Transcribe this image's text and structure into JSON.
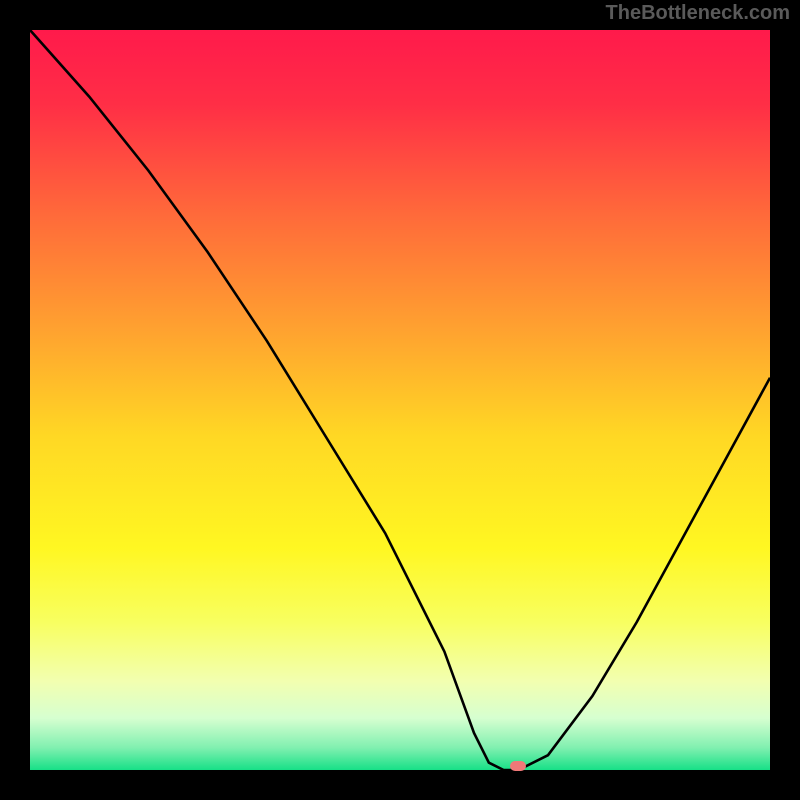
{
  "watermark": "TheBottleneck.com",
  "chart_data": {
    "type": "line",
    "title": "",
    "xlabel": "",
    "ylabel": "",
    "x_range": [
      0,
      100
    ],
    "y_range": [
      0,
      100
    ],
    "series": [
      {
        "name": "bottleneck-curve",
        "x": [
          0,
          8,
          16,
          24,
          32,
          40,
          48,
          56,
          60,
          62,
          64,
          66,
          70,
          76,
          82,
          88,
          94,
          100
        ],
        "y": [
          100,
          91,
          81,
          70,
          58,
          45,
          32,
          16,
          5,
          1,
          0,
          0,
          2,
          10,
          20,
          31,
          42,
          53
        ]
      }
    ],
    "marker": {
      "x": 66,
      "y": 0.5
    },
    "gradient_stops": [
      {
        "pos": 0.0,
        "color": "#ff1a4b"
      },
      {
        "pos": 0.1,
        "color": "#ff2e46"
      },
      {
        "pos": 0.25,
        "color": "#ff6a3a"
      },
      {
        "pos": 0.4,
        "color": "#ffa030"
      },
      {
        "pos": 0.55,
        "color": "#ffd824"
      },
      {
        "pos": 0.7,
        "color": "#fff722"
      },
      {
        "pos": 0.8,
        "color": "#f8ff60"
      },
      {
        "pos": 0.88,
        "color": "#f2ffb0"
      },
      {
        "pos": 0.93,
        "color": "#d6ffd0"
      },
      {
        "pos": 0.97,
        "color": "#80f0b0"
      },
      {
        "pos": 1.0,
        "color": "#17e087"
      }
    ]
  }
}
